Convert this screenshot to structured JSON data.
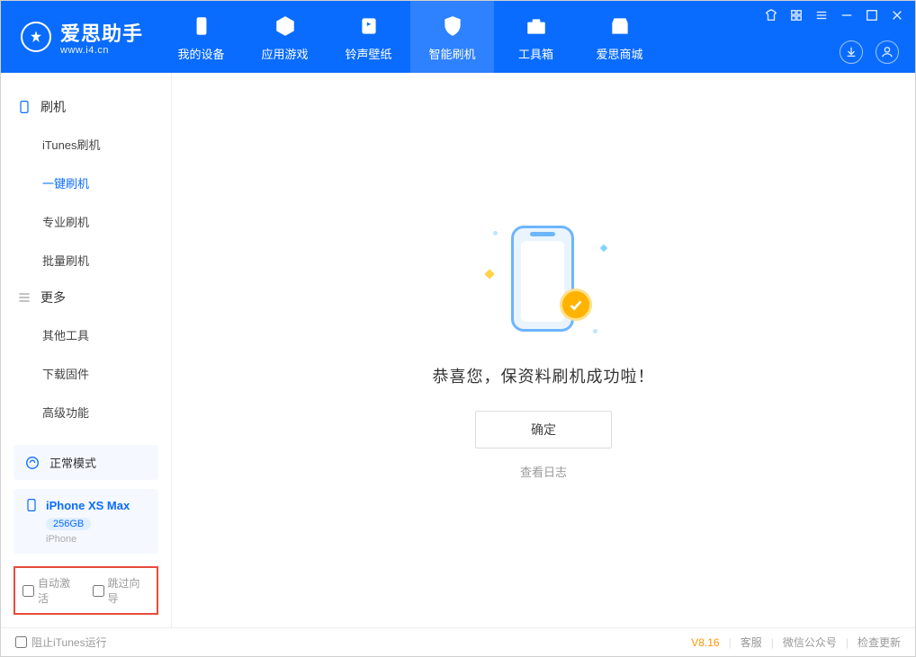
{
  "app": {
    "name": "爱思助手",
    "url": "www.i4.cn"
  },
  "nav": {
    "items": [
      {
        "label": "我的设备"
      },
      {
        "label": "应用游戏"
      },
      {
        "label": "铃声壁纸"
      },
      {
        "label": "智能刷机"
      },
      {
        "label": "工具箱"
      },
      {
        "label": "爱思商城"
      }
    ]
  },
  "sidebar": {
    "group1_title": "刷机",
    "group1_items": [
      "iTunes刷机",
      "一键刷机",
      "专业刷机",
      "批量刷机"
    ],
    "group2_title": "更多",
    "group2_items": [
      "其他工具",
      "下载固件",
      "高级功能"
    ]
  },
  "mode": {
    "label": "正常模式"
  },
  "device": {
    "name": "iPhone XS Max",
    "capacity": "256GB",
    "type": "iPhone"
  },
  "checks": {
    "auto_activate": "自动激活",
    "skip_guide": "跳过向导"
  },
  "main": {
    "success": "恭喜您，保资料刷机成功啦！",
    "ok": "确定",
    "view_log": "查看日志"
  },
  "statusbar": {
    "block_itunes": "阻止iTunes运行",
    "version": "V8.16",
    "links": [
      "客服",
      "微信公众号",
      "检查更新"
    ]
  }
}
